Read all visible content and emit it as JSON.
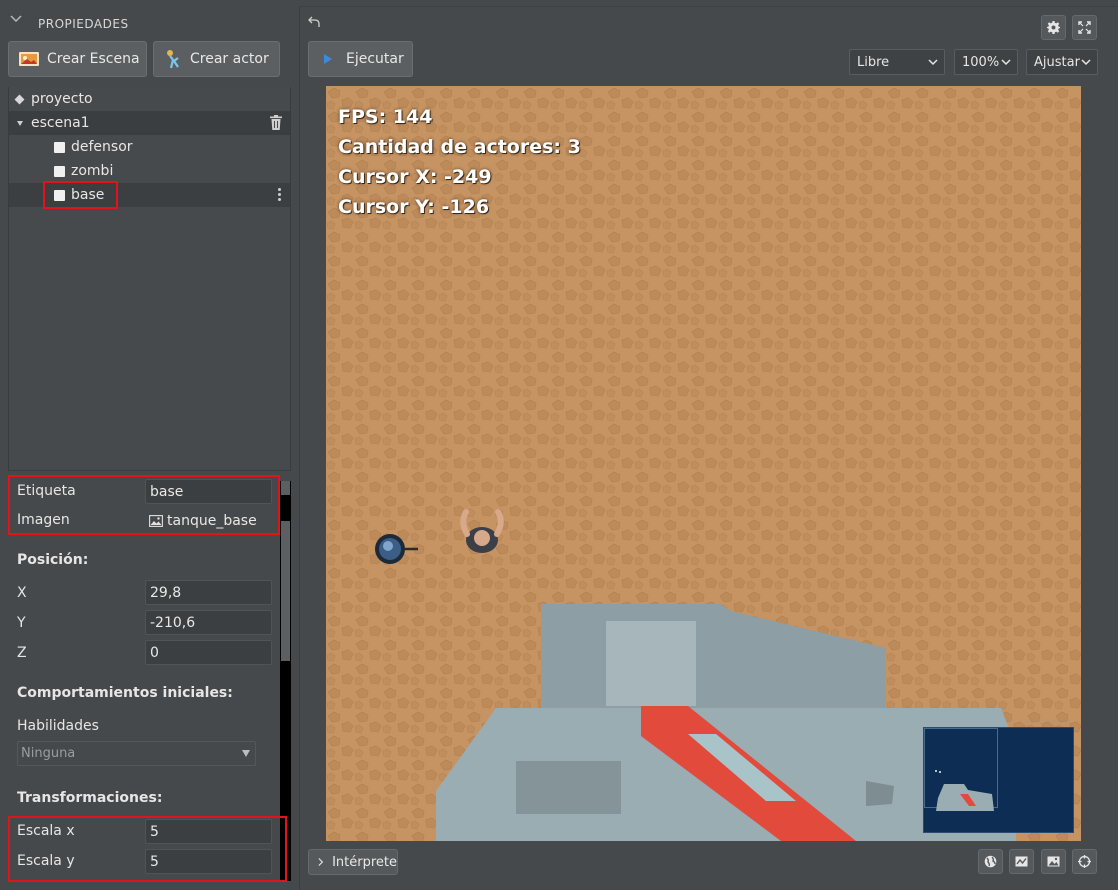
{
  "panel": {
    "title": "PROPIEDADES",
    "btn_crear_escena": "Crear Escena",
    "btn_crear_actor": "Crear actor"
  },
  "tree": {
    "project": "proyecto",
    "scene": "escena1",
    "actors": [
      "defensor",
      "zombi",
      "base"
    ]
  },
  "props": {
    "etiqueta_label": "Etiqueta",
    "etiqueta_value": "base",
    "imagen_label": "Imagen",
    "imagen_value": "tanque_base",
    "posicion_title": "Posición:",
    "x_label": "X",
    "x_value": "29,8",
    "y_label": "Y",
    "y_value": "-210,6",
    "z_label": "Z",
    "z_value": "0",
    "comportamientos_title": "Comportamientos iniciales:",
    "habilidades_label": "Habilidades",
    "habilidades_value": "Ninguna",
    "transformaciones_title": "Transformaciones:",
    "escala_x_label": "Escala x",
    "escala_x_value": "5",
    "escala_y_label": "Escala y",
    "escala_y_value": "5"
  },
  "toolbar": {
    "ejecutar": "Ejecutar",
    "libre": "Libre",
    "zoom": "100%",
    "ajustar": "Ajustar"
  },
  "hud": {
    "fps": "FPS: 144",
    "actores": "Cantidad de actores: 3",
    "cursor_x": "Cursor X: -249",
    "cursor_y": "Cursor Y: -126"
  },
  "bottom": {
    "interprete": "Intérprete"
  },
  "colors": {
    "ground": "#c69362",
    "highlight": "#e0141a",
    "accent_play": "#3a8ae0",
    "minimap_bg": "#0e2d54"
  }
}
